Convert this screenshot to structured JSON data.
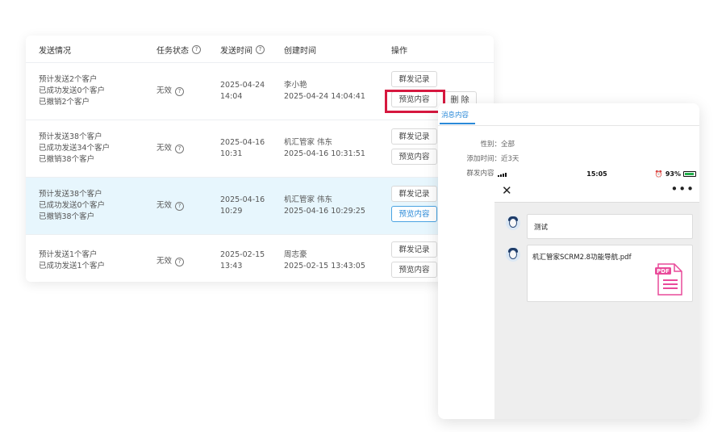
{
  "table": {
    "headers": {
      "sending": "发送情况",
      "task_status": "任务状态",
      "send_time": "发送时间",
      "create_time": "创建时间",
      "actions": "操作"
    },
    "rows": [
      {
        "line1": "预计发送2个客户",
        "line2": "已成功发送0个客户",
        "line3": "已撤销2个客户",
        "status": "无效",
        "send_date": "2025-04-24",
        "send_clock": "14:04",
        "creator": "李小艳",
        "created_at": "2025-04-24 14:04:41",
        "record_btn": "群发记录",
        "preview_btn": "预览内容"
      },
      {
        "line1": "预计发送38个客户",
        "line2": "已成功发送34个客户",
        "line3": "已撤销38个客户",
        "status": "无效",
        "send_date": "2025-04-16",
        "send_clock": "10:31",
        "creator": "机汇管家 伟东",
        "created_at": "2025-04-16 10:31:51",
        "record_btn": "群发记录",
        "preview_btn": "预览内容"
      },
      {
        "line1": "预计发送38个客户",
        "line2": "已成功发送0个客户",
        "line3": "已撤销38个客户",
        "status": "无效",
        "send_date": "2025-04-16",
        "send_clock": "10:29",
        "creator": "机汇管家 伟东",
        "created_at": "2025-04-16 10:29:25",
        "record_btn": "群发记录",
        "preview_btn": "预览内容"
      },
      {
        "line1": "预计发送1个客户",
        "line2": "已成功发送1个客户",
        "line3": "",
        "status": "无效",
        "send_date": "2025-02-15",
        "send_clock": "13:43",
        "creator": "周志豪",
        "created_at": "2025-02-15 13:43:05",
        "record_btn": "群发记录",
        "preview_btn": "预览内容"
      }
    ],
    "delete_btn": "删 除",
    "help_icon": "question-circle-icon"
  },
  "preview": {
    "tab_label": "消息内容",
    "gender_label": "性别：",
    "gender_value": "全部",
    "added_label": "添加时间：",
    "added_value": "近3天",
    "content_label": "群发内容：",
    "phone": {
      "time": "15:05",
      "battery": "93%",
      "battery_level": 0.93,
      "close_icon": "close-icon",
      "more_icon": "more-icon",
      "msg_text": "测试",
      "file_name": "机汇管家SCRM2.8功能导航.pdf",
      "file_badge": "PDF"
    }
  },
  "colors": {
    "accent": "#2b8ad8",
    "highlight_row": "#e7f6fd",
    "red_frame": "#d6183f",
    "pdf_pink": "#e94a9a"
  }
}
